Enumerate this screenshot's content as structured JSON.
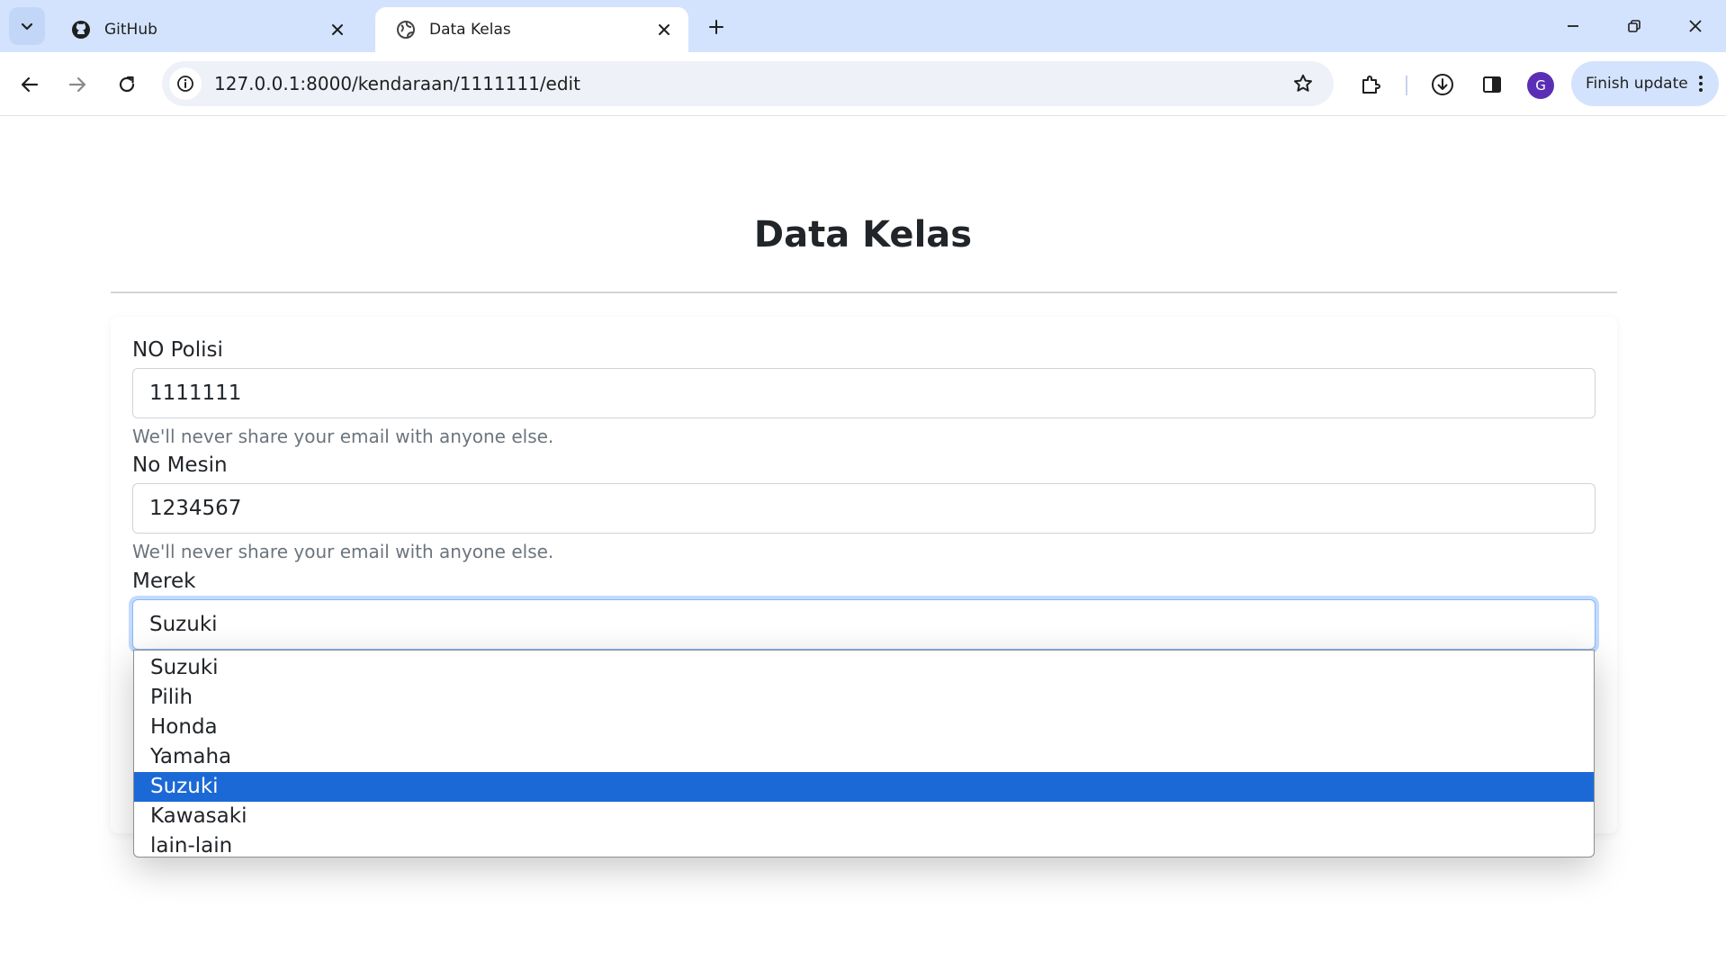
{
  "browser": {
    "tabs": [
      {
        "title": "GitHub",
        "icon": "github-icon",
        "active": false
      },
      {
        "title": "Data Kelas",
        "icon": "globe-icon",
        "active": true
      }
    ],
    "url": "127.0.0.1:8000/kendaraan/1111111/edit",
    "finish_update_label": "Finish update",
    "profile_initial": "G",
    "colors": {
      "tabstrip": "#d3e3fd",
      "avatar": "#5b2fb5",
      "selected_option": "#1b69d6"
    }
  },
  "page": {
    "heading": "Data Kelas",
    "form": {
      "no_polisi": {
        "label": "NO Polisi",
        "value": "1111111",
        "help": "We'll never share your email with anyone else."
      },
      "no_mesin": {
        "label": "No Mesin",
        "value": "1234567",
        "help": "We'll never share your email with anyone else."
      },
      "merek": {
        "label": "Merek",
        "selected": "Suzuki",
        "options": [
          "Suzuki",
          "Pilih",
          "Honda",
          "Yamaha",
          "Suzuki",
          "Kawasaki",
          "lain-lain"
        ],
        "highlighted_index": 4
      }
    }
  }
}
